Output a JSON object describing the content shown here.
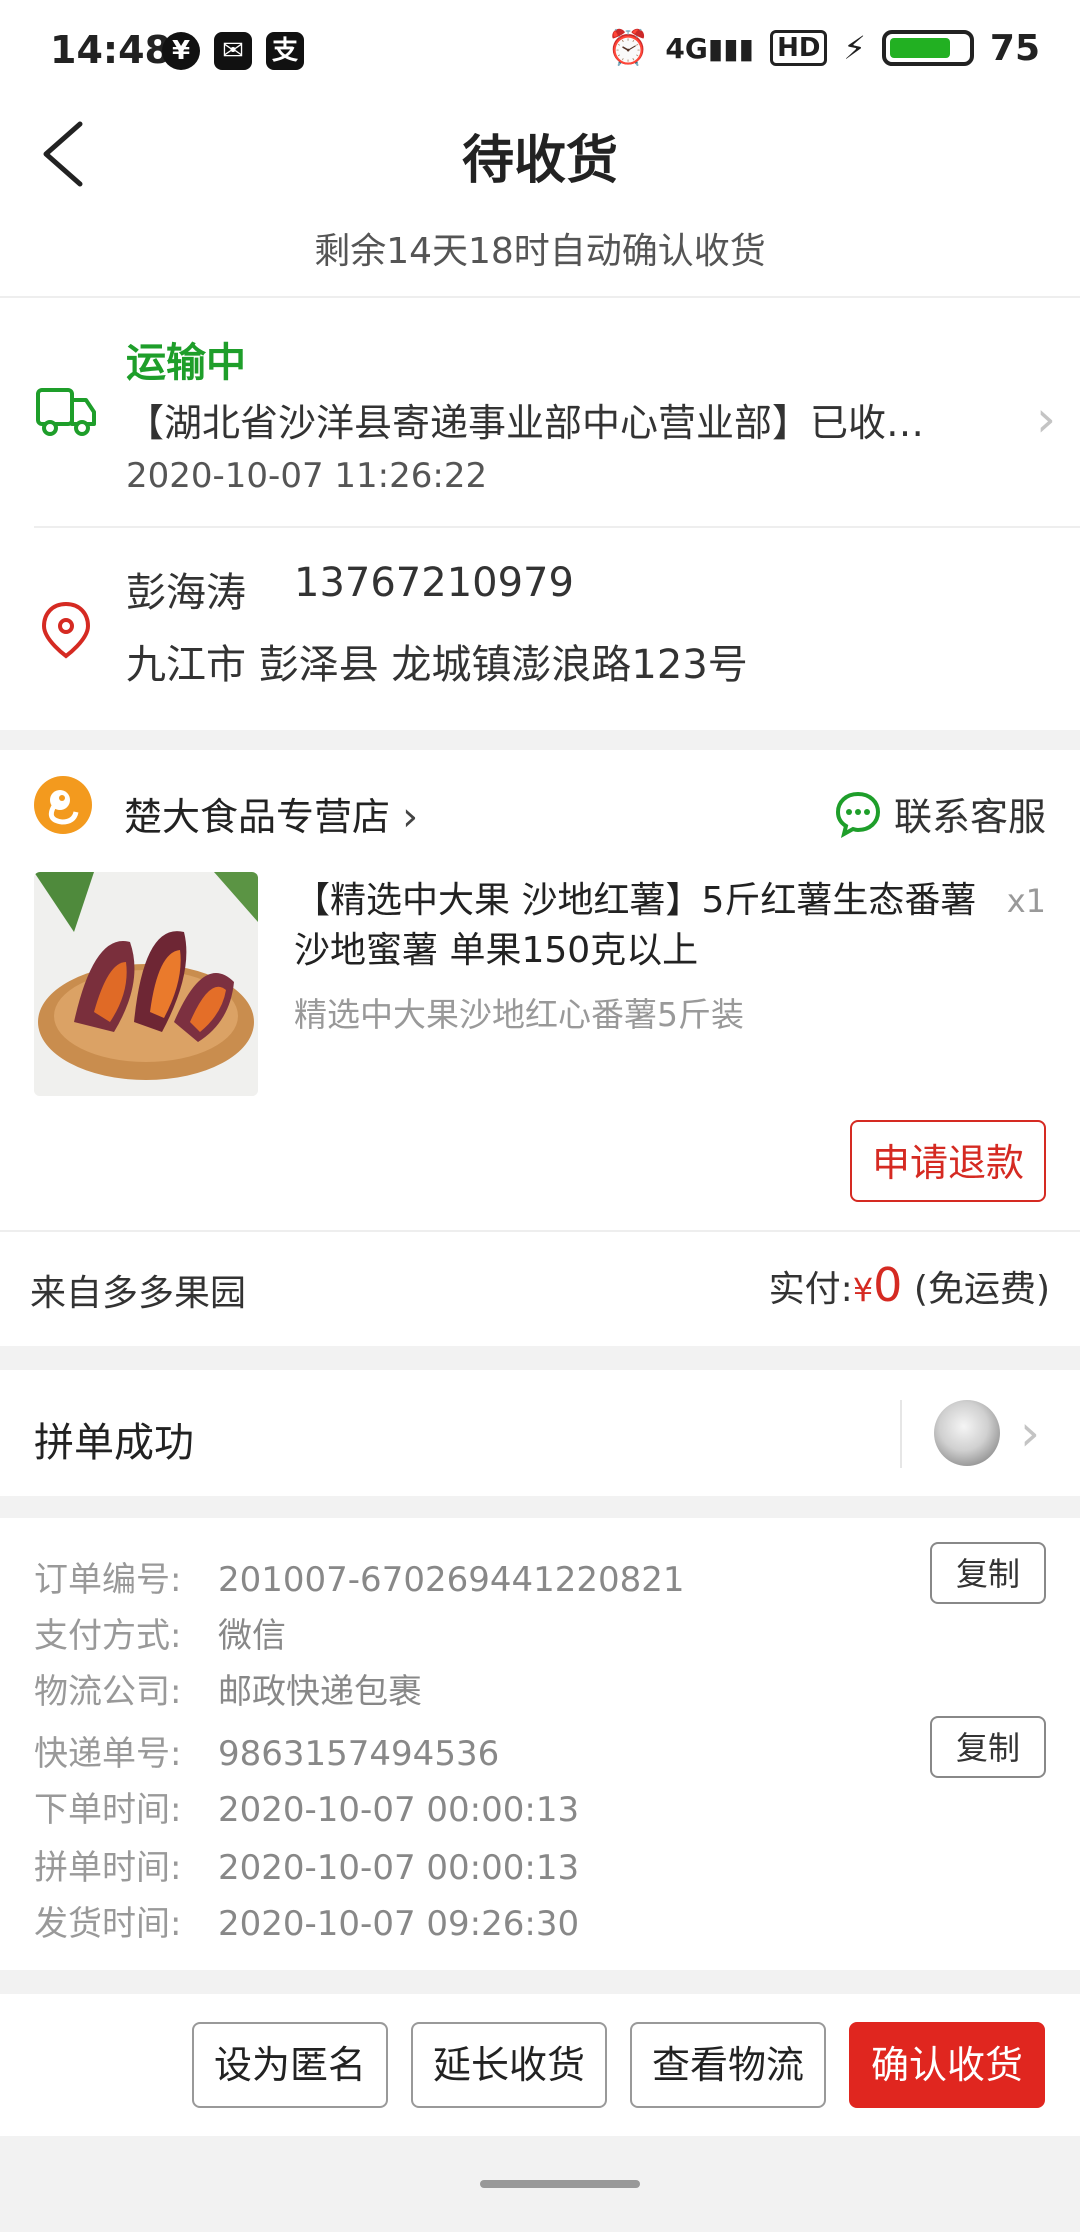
{
  "status_bar": {
    "time": "14:48",
    "battery": "75",
    "network": "4G",
    "hd": "HD",
    "colors": {
      "battery_fill": "#22b022"
    }
  },
  "header": {
    "title": "待收货",
    "subtitle": "剩余14天18时自动确认收货",
    "back_icon": "back-arrow-icon"
  },
  "logistics": {
    "status": "运输中",
    "message": "【湖北省沙洋县寄递事业部中心营业部】已收…",
    "time": "2020-10-07 11:26:22",
    "icon": "truck-icon"
  },
  "address": {
    "name": "彭海涛",
    "phone": "13767210979",
    "line": "九江市 彭泽县 龙城镇澎浪路123号",
    "icon": "location-pin-icon"
  },
  "store": {
    "name": "楚大食品专营店",
    "service_label": "联系客服",
    "product": {
      "title": "【精选中大果 沙地红薯】5斤红薯生态番薯沙地蜜薯 单果150克以上",
      "quantity": "x1",
      "spec": "精选中大果沙地红心番薯5斤装"
    },
    "refund_label": "申请退款"
  },
  "payment": {
    "source": "来自多多果园",
    "paid_label": "实付:",
    "currency": "¥",
    "amount": "0",
    "shipping_note": "(免运费)"
  },
  "group": {
    "title": "拼单成功"
  },
  "details": {
    "rows": [
      {
        "label": "订单编号:",
        "value": "201007-670269441220821",
        "copy": true
      },
      {
        "label": "支付方式:",
        "value": "微信",
        "copy": false
      },
      {
        "label": "物流公司:",
        "value": "邮政快递包裹",
        "copy": false
      },
      {
        "label": "快递单号:",
        "value": "9863157494536",
        "copy": true
      },
      {
        "label": "下单时间:",
        "value": "2020-10-07 00:00:13",
        "copy": false
      },
      {
        "label": "拼单时间:",
        "value": "2020-10-07 00:00:13",
        "copy": false
      },
      {
        "label": "发货时间:",
        "value": "2020-10-07 09:26:30",
        "copy": false
      }
    ],
    "copy_label": "复制"
  },
  "actions": {
    "anonymous": "设为匿名",
    "extend": "延长收货",
    "logistics": "查看物流",
    "confirm": "确认收货",
    "colors": {
      "primary": "#e0261f"
    }
  }
}
